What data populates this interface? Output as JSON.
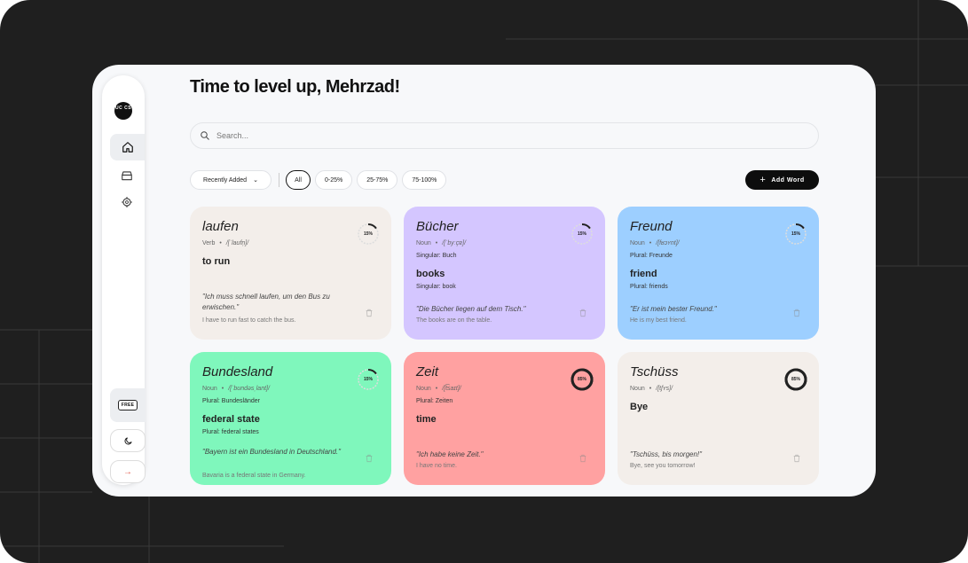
{
  "colors": {
    "frame": "#1f1f1f",
    "app_bg": "#f7f8fa",
    "beige": "#f3eeea",
    "purple": "#d4c6ff",
    "blue": "#9dcfff",
    "green": "#7ff7bc",
    "red": "#ffa1a1",
    "accent_dark": "#0d0d0d"
  },
  "sidebar": {
    "logo_text": "UC CS",
    "nav": [
      {
        "name": "home",
        "icon": "home-icon",
        "active": true
      },
      {
        "name": "library",
        "icon": "archive-icon",
        "active": false
      },
      {
        "name": "settings",
        "icon": "gear-icon",
        "active": false
      }
    ],
    "plan_badge": "FREE",
    "theme_icon": "moon-icon",
    "logout_icon": "arrow-right-icon",
    "logout_glyph": "→"
  },
  "header": {
    "title": "Time to level up, Mehrzad!"
  },
  "search": {
    "placeholder": "Search..."
  },
  "filters": {
    "sort_label": "Recently Added",
    "chips": [
      "All",
      "0-25%",
      "25-75%",
      "75-100%"
    ],
    "active_chip": "All"
  },
  "add_button": {
    "label": "Add Word"
  },
  "cards": [
    {
      "word": "laufen",
      "pos": "Verb",
      "ipa": "/[ˈlaʊfn̩]/",
      "note1": "",
      "translation": "to run",
      "note2": "",
      "example": "\"Ich muss schnell laufen, um den Bus zu erwischen.\"",
      "example_translation": "I have to run fast to catch the bus.",
      "progress": "15%",
      "progress_value": 0.15,
      "color": "#f3eeea"
    },
    {
      "word": "Bücher",
      "pos": "Noun",
      "ipa": "/[ˈbyːçɐ]/",
      "note1": "Singular: Buch",
      "translation": "books",
      "note2": "Singular: book",
      "example": "\"Die Bücher liegen auf dem Tisch.\"",
      "example_translation": "The books are on the table.",
      "progress": "15%",
      "progress_value": 0.15,
      "color": "#d4c6ff"
    },
    {
      "word": "Freund",
      "pos": "Noun",
      "ipa": "/[fʁɔʏnt]/",
      "note1": "Plural: Freunde",
      "translation": "friend",
      "note2": "Plural: friends",
      "example": "\"Er ist mein bester Freund.\"",
      "example_translation": "He is my best friend.",
      "progress": "15%",
      "progress_value": 0.15,
      "color": "#9dcfff"
    },
    {
      "word": "Bundesland",
      "pos": "Noun",
      "ipa": "/[ˈbʊndəsˌlant]/",
      "note1": "Plural: Bundesländer",
      "translation": "federal state",
      "note2": "Plural: federal states",
      "example": "\"Bayern ist ein Bundesland in Deutschland.\"",
      "example_translation": "Bavaria is a federal state in Germany.",
      "progress": "15%",
      "progress_value": 0.15,
      "color": "#7ff7bc"
    },
    {
      "word": "Zeit",
      "pos": "Noun",
      "ipa": "/[t͡saɪt]/",
      "note1": "Plural: Zeiten",
      "translation": "time",
      "note2": "",
      "example": "\"Ich habe keine Zeit.\"",
      "example_translation": "I have no time.",
      "progress": "85%",
      "progress_value": 0.85,
      "color": "#ffa1a1"
    },
    {
      "word": "Tschüss",
      "pos": "Noun",
      "ipa": "/[tʃʏs]/",
      "note1": "",
      "translation": "Bye",
      "note2": "",
      "example": "\"Tschüss, bis morgen!\"",
      "example_translation": "Bye, see you tomorrow!",
      "progress": "85%",
      "progress_value": 0.85,
      "color": "#f3eeea"
    }
  ]
}
